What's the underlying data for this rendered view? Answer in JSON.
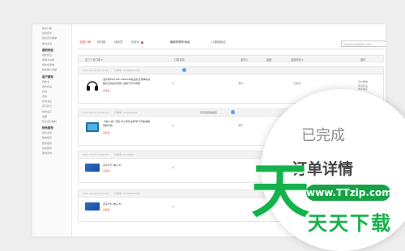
{
  "tabs": [
    {
      "label": "全部订单",
      "active": true
    },
    {
      "label": "待付款"
    },
    {
      "label": "待收货"
    },
    {
      "label": "待评价",
      "badge": "1"
    }
  ],
  "center_tab_1": "最新购物车商品",
  "center_tab_2": "订单回收站",
  "search": {
    "placeholder": "商品名称/商品编号/订单号"
  },
  "sidebar": [
    {
      "title": "",
      "items": [
        "我的订单",
        "我的预售",
        "我的评价晒单",
        "我的关注"
      ]
    },
    {
      "title": "我的钱包",
      "items": [
        "我的京豆",
        "购物卡余额",
        "我的优惠券",
        "我的账户余额"
      ]
    },
    {
      "title": "客户服务",
      "items": [
        "我的卡",
        "退款售后",
        "投诉",
        "咨询",
        "我的消息",
        "京东积分",
        "我的盒子",
        "发票",
        "官方会员福利"
      ]
    },
    {
      "title": "特色服务",
      "items": [
        "我的活动",
        "购物助手",
        "装修服务",
        "回收服务",
        "我的定制"
      ]
    }
  ],
  "table_header": {
    "time_filter": "近三个月订单",
    "details": "订单详情",
    "user": "收货人",
    "amount": "金额",
    "status": "全部状态",
    "ops": "操作"
  },
  "orders": [
    {
      "date": "2021-04-18 10:12:35",
      "number": "订单号: 47098946531",
      "shop": "",
      "title": "漫步者EDIFIER W820NB双金标主动降噪头戴式无线蓝牙耳机 适用于华为苹果",
      "tag": "卖家送",
      "qty": "x1",
      "user": "李晓",
      "amount": "",
      "status": "已完成",
      "ops": [
        "评价晒单",
        "申请售后",
        "再次购买"
      ]
    },
    {
      "date": "2021-04-17 12:25:44",
      "number": "订单号: 474094566",
      "shop": "京东自营旗舰店",
      "title": "【电子书】平板 中小学作业帮学习平板电脑 家教专用",
      "tag": "卖家送",
      "qty": "x1",
      "user": "李晓",
      "amount": "",
      "status": "已完成",
      "ops": [
        "评价晒单",
        "申请售后"
      ]
    },
    {
      "date": "2021-04-16 22:06:25",
      "number": "订单号: 4739845",
      "shop": "",
      "title": "京东E卡 (电子卡)",
      "tag": "卖家送",
      "qty": "x1",
      "user": "",
      "amount": "",
      "status": "",
      "ops": []
    },
    {
      "date": "2021-04-12 07:03:06",
      "number": "订单号: 47398454906",
      "shop": "",
      "title": "京东E卡 (电子卡)",
      "tag": "卖家送",
      "qty": "x1",
      "user": "",
      "amount": "",
      "status": "",
      "ops": []
    }
  ],
  "magnifier": {
    "status": "已完成",
    "detail": "订单详情"
  },
  "watermark": {
    "glyph": "天",
    "url": "www.TTzip.com",
    "text": "天天下载"
  },
  "colors": {
    "accent": "#e4393c",
    "watermark_green": "#13b24a",
    "link_blue": "#5aa0e8"
  }
}
